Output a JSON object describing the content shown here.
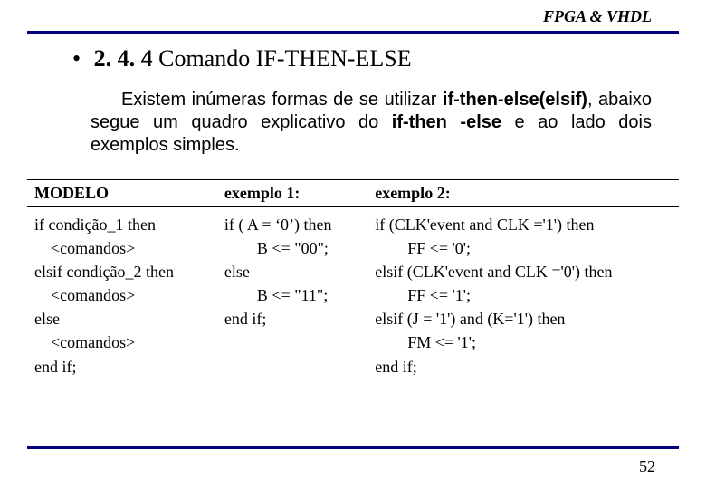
{
  "header": {
    "label": "FPGA & VHDL"
  },
  "title": {
    "bullet": "•",
    "number": "2. 4. 4",
    "text": "Comando IF-THEN-ELSE"
  },
  "paragraph": {
    "lead": "Existem inúmeras formas de se utilizar ",
    "b1": "if-then-else(elsif)",
    "mid": ", abaixo segue um quadro explicativo do ",
    "b2": "if-then -else",
    "tail": " e ao lado dois exemplos simples."
  },
  "table": {
    "headers": [
      "MODELO",
      "exemplo 1:",
      "exemplo 2:"
    ],
    "cells": [
      "if condição_1 then\n    <comandos>\nelsif condição_2 then\n    <comandos>\nelse\n    <comandos>\nend if;",
      "if ( A = ‘0’) then\n        B <= \"00\";\nelse\n        B <= \"11\";\nend if;",
      "if (CLK'event and CLK ='1') then\n        FF <= '0';\nelsif (CLK'event and CLK ='0') then\n        FF <= '1';\nelsif (J = '1') and (K='1') then\n        FM <= '1';\nend if;"
    ]
  },
  "page_number": "52"
}
